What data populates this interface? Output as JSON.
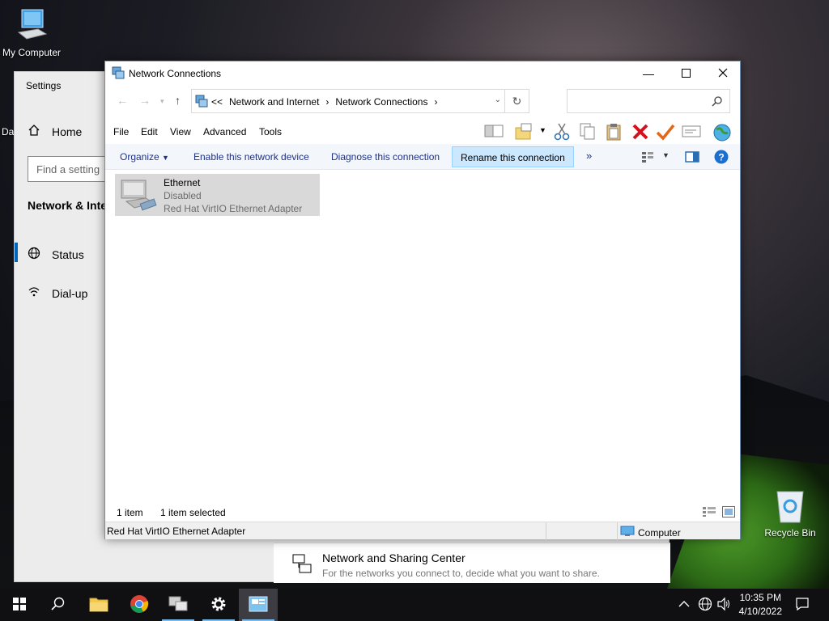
{
  "desktop": {
    "my_computer_label": "My Computer",
    "recycle_bin_label": "Recycle Bin",
    "partial_label": "Da"
  },
  "settings": {
    "title": "Settings",
    "home_label": "Home",
    "search_placeholder": "Find a setting",
    "section_label": "Network & Inte",
    "nav_items": [
      {
        "label": "Status",
        "icon": "globe-icon",
        "selected": true
      },
      {
        "label": "Dial-up",
        "icon": "dialup-icon",
        "selected": false
      }
    ],
    "bottom_card": {
      "label": "Network and Sharing Center",
      "sub": "For the networks you connect to, decide what you want to share."
    }
  },
  "explorer": {
    "title": "Network Connections",
    "breadcrumb": {
      "overflow": "<<",
      "items": [
        "Network and Internet",
        "Network Connections"
      ]
    },
    "menu": [
      "File",
      "Edit",
      "View",
      "Advanced",
      "Tools"
    ],
    "commands": [
      {
        "label": "Organize",
        "dropdown": true
      },
      {
        "label": "Enable this network device"
      },
      {
        "label": "Diagnose this connection"
      },
      {
        "label": "Rename this connection",
        "selected": true
      },
      {
        "label": "»"
      }
    ],
    "connection": {
      "name": "Ethernet",
      "status": "Disabled",
      "device": "Red Hat VirtIO Ethernet Adapter"
    },
    "status": {
      "count": "1 item",
      "selected": "1 item selected"
    },
    "details": {
      "text": "Red Hat VirtIO Ethernet Adapter",
      "zone": "Computer"
    }
  },
  "taskbar": {
    "time": "10:35 PM",
    "date": "4/10/2022",
    "accent": "#76b9ed"
  }
}
